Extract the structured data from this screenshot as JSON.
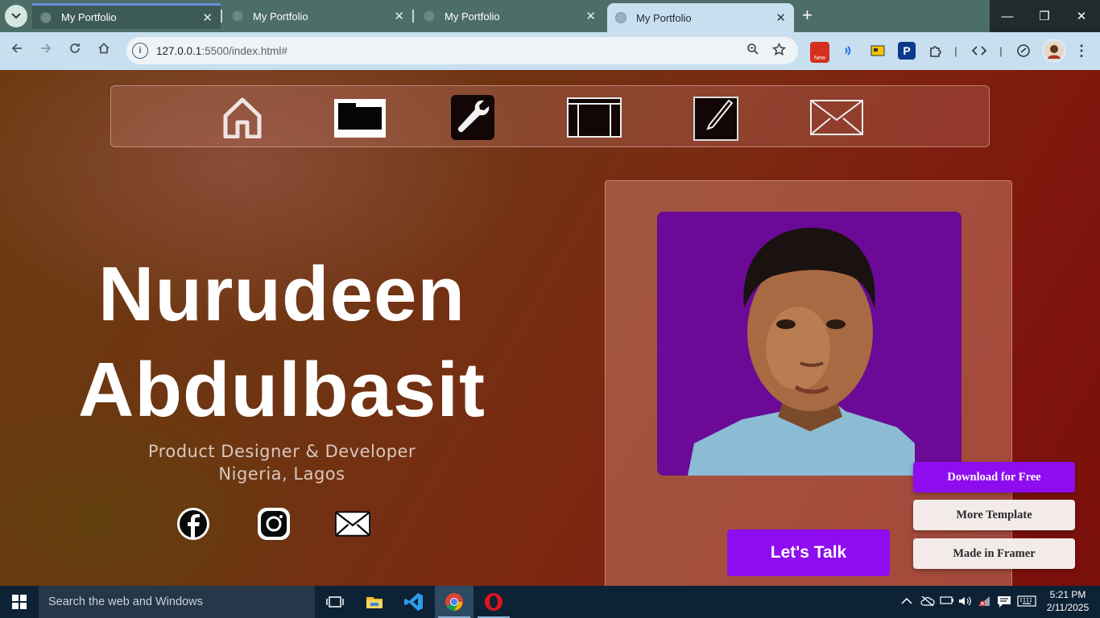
{
  "browser": {
    "tabs": [
      {
        "title": "My Portfolio",
        "close": "✕"
      },
      {
        "title": "My Portfolio",
        "close": "✕"
      },
      {
        "title": "My Portfolio",
        "close": "✕"
      },
      {
        "title": "My Portfolio",
        "close": "✕"
      }
    ],
    "new_tab": "+",
    "url_host": "127.0.0.1",
    "url_rest": ":5500/index.html#",
    "window_controls": {
      "minimize": "—",
      "restore": "❐",
      "close": "✕"
    },
    "extension_badge": "New"
  },
  "nav": {
    "items": [
      {
        "icon": "home-icon"
      },
      {
        "icon": "folder-icon"
      },
      {
        "icon": "wrench-icon"
      },
      {
        "icon": "portfolio-icon"
      },
      {
        "icon": "edit-icon"
      },
      {
        "icon": "mail-icon"
      }
    ]
  },
  "hero": {
    "first_name": "Nurudeen",
    "last_name": "Abdulbasit",
    "role": "Product Designer & Developer",
    "location": "Nigeria, Lagos"
  },
  "social": [
    {
      "icon": "facebook-icon"
    },
    {
      "icon": "instagram-icon"
    },
    {
      "icon": "mail-icon"
    }
  ],
  "cta": {
    "talk": "Let's Talk"
  },
  "framer": {
    "download": "Download for Free",
    "more": "More Template",
    "made": "Made in Framer"
  },
  "taskbar": {
    "search_placeholder": "Search the web and Windows",
    "time": "5:21 PM",
    "date": "2/11/2025"
  },
  "colors": {
    "accent_purple": "#8e0cf0",
    "tab_bar": "#4d6e67",
    "toolbar": "#c8dff0"
  }
}
